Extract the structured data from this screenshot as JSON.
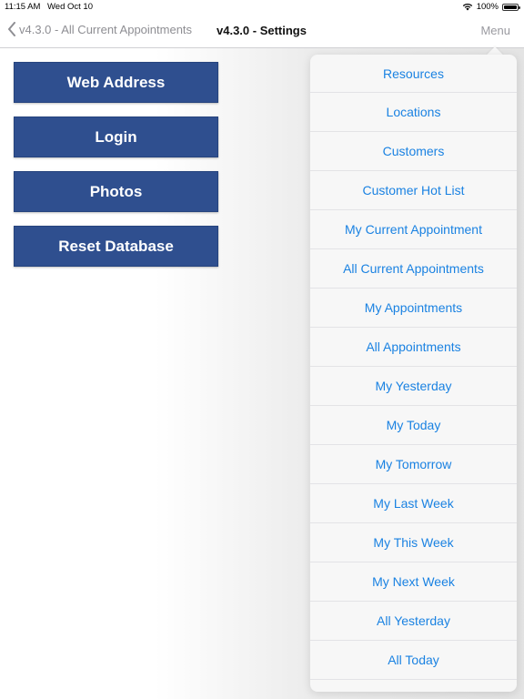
{
  "status_bar": {
    "time": "11:15 AM",
    "date": "Wed Oct 10",
    "battery": "100%"
  },
  "nav": {
    "back_label": "v4.3.0 - All Current Appointments",
    "title": "v4.3.0 - Settings",
    "menu_label": "Menu"
  },
  "buttons": {
    "web_address": "Web Address",
    "login": "Login",
    "photos": "Photos",
    "reset_database": "Reset Database"
  },
  "menu": {
    "items": [
      "Resources",
      "Locations",
      "Customers",
      "Customer Hot List",
      "My Current Appointment",
      "All Current Appointments",
      "My Appointments",
      "All Appointments",
      "My Yesterday",
      "My Today",
      "My Tomorrow",
      "My Last Week",
      "My This Week",
      "My Next Week",
      "All Yesterday",
      "All Today"
    ]
  },
  "colors": {
    "button_bg": "#2f4f8f",
    "menu_link": "#1a82e2",
    "menu_bg": "#f7f7f7"
  }
}
